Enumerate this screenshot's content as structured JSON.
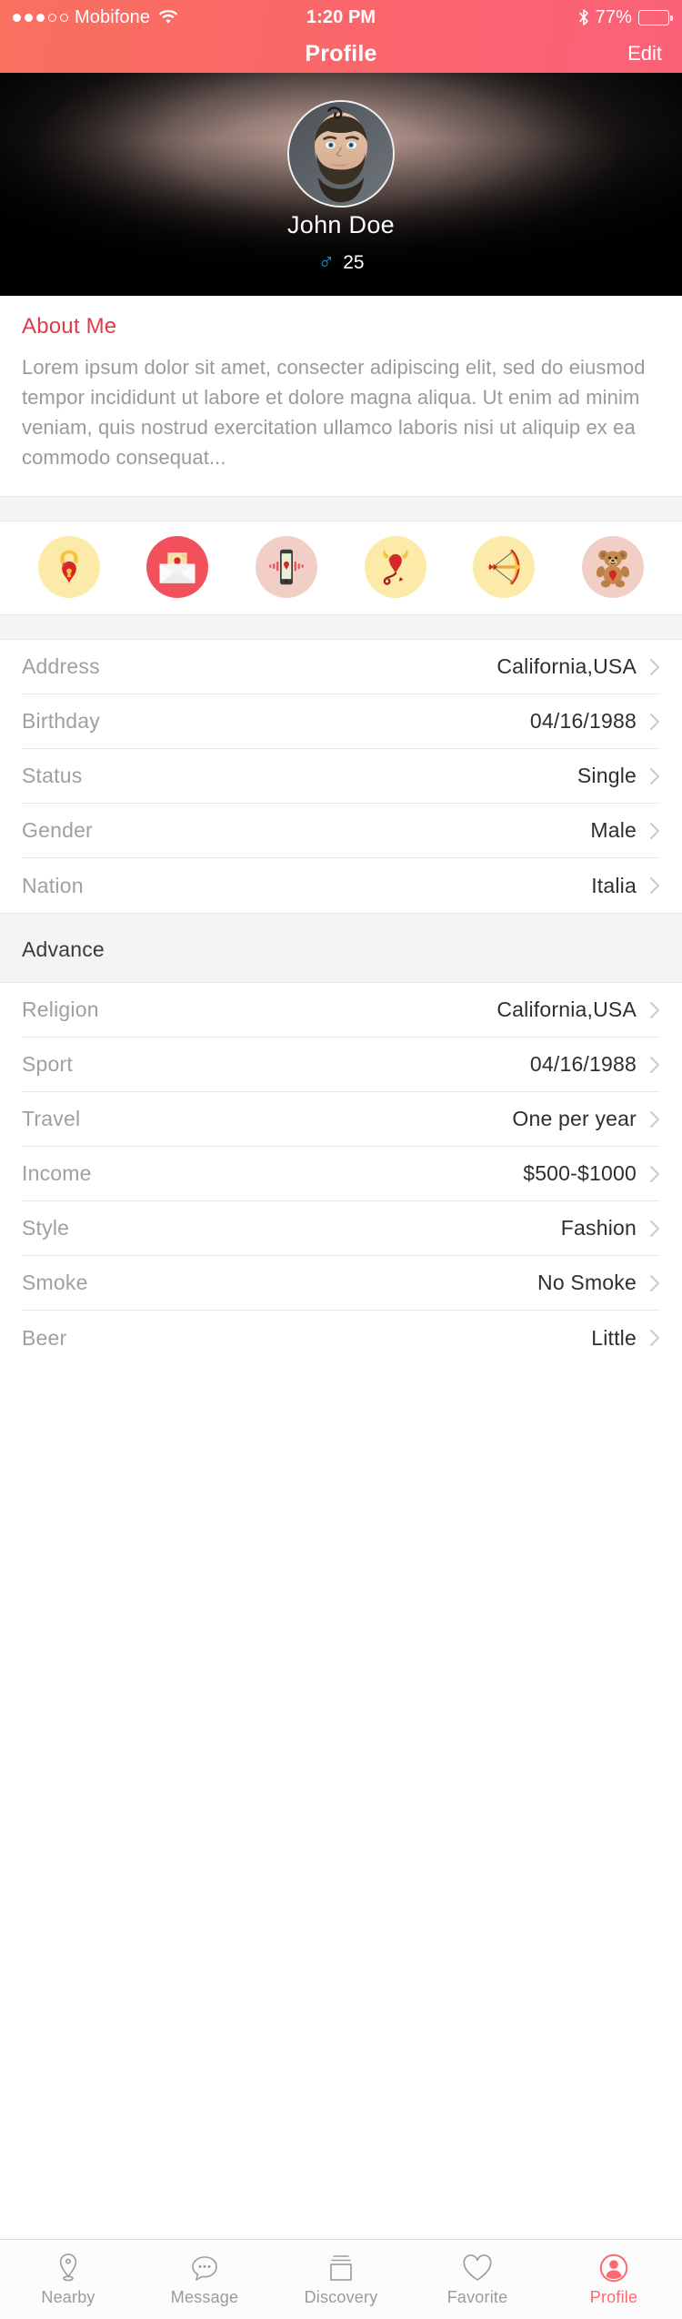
{
  "status_bar": {
    "signal_dots_filled": 3,
    "signal_dots_total": 5,
    "carrier": "Mobifone",
    "wifi_icon": "wifi-icon",
    "time": "1:20 PM",
    "bluetooth_icon": "bluetooth-icon",
    "battery_percent": "77%",
    "battery_level": 77
  },
  "navbar": {
    "title": "Profile",
    "edit_label": "Edit"
  },
  "hero": {
    "avatar_icon": "avatar-photo",
    "name": "John Doe",
    "gender_symbol": "♂",
    "age": "25"
  },
  "about": {
    "title": "About Me",
    "body": "Lorem ipsum dolor sit amet, consecter adipiscing elit, sed do eiusmod tempor incididunt ut labore et dolore magna aliqua. Ut enim ad minim veniam, quis nostrud exercitation ullamco laboris nisi ut aliquip ex ea commodo consequat..."
  },
  "interest_icons": [
    {
      "name": "heart-lock-icon",
      "bg": "#fbeaa8"
    },
    {
      "name": "love-letter-icon",
      "bg": "#f2505a"
    },
    {
      "name": "phone-heart-icon",
      "bg": "#f2cfc6"
    },
    {
      "name": "devil-heart-icon",
      "bg": "#fbeaa8"
    },
    {
      "name": "bow-arrow-icon",
      "bg": "#fbeaa8"
    },
    {
      "name": "teddy-bear-icon",
      "bg": "#f2cfc6"
    }
  ],
  "basic_info": {
    "rows": [
      {
        "label": "Address",
        "value": "California,USA"
      },
      {
        "label": "Birthday",
        "value": "04/16/1988"
      },
      {
        "label": "Status",
        "value": "Single"
      },
      {
        "label": "Gender",
        "value": "Male"
      },
      {
        "label": "Nation",
        "value": "Italia"
      }
    ]
  },
  "advance": {
    "title": "Advance",
    "rows": [
      {
        "label": "Religion",
        "value": "California,USA"
      },
      {
        "label": "Sport",
        "value": "04/16/1988"
      },
      {
        "label": "Travel",
        "value": "One per year"
      },
      {
        "label": "Income",
        "value": "$500-$1000"
      },
      {
        "label": "Style",
        "value": "Fashion"
      },
      {
        "label": "Smoke",
        "value": "No Smoke"
      },
      {
        "label": "Beer",
        "value": "Little"
      }
    ]
  },
  "tabbar": {
    "items": [
      {
        "label": "Nearby",
        "icon": "map-pin-icon",
        "active": false
      },
      {
        "label": "Message",
        "icon": "chat-bubble-icon",
        "active": false
      },
      {
        "label": "Discovery",
        "icon": "cards-stack-icon",
        "active": false
      },
      {
        "label": "Favorite",
        "icon": "heart-outline-icon",
        "active": false
      },
      {
        "label": "Profile",
        "icon": "person-circle-icon",
        "active": true
      }
    ]
  },
  "colors": {
    "accent": "#fc6a6f",
    "header_gradient_start": "#f9705f",
    "header_gradient_end": "#fa6179",
    "about_title": "#e03b4a",
    "male_symbol": "#1b9ae0"
  }
}
